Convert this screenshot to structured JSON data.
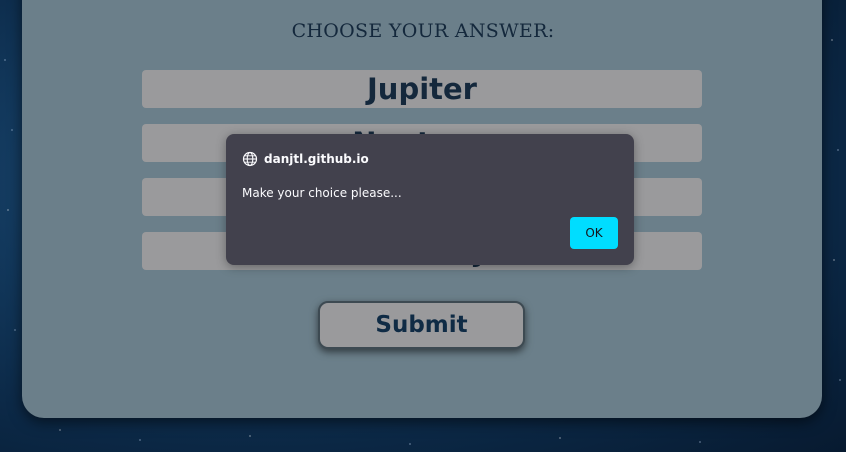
{
  "quiz": {
    "heading": "CHOOSE YOUR ANSWER:",
    "answers": [
      "Jupiter",
      "Neptune",
      "",
      "Mercury"
    ],
    "submit_label": "Submit"
  },
  "dialog": {
    "origin": "danjtl.github.io",
    "origin_icon": "globe-icon",
    "message": "Make your choice please...",
    "ok_label": "OK"
  },
  "colors": {
    "card_background": "#6b7f8a",
    "answer_background": "#9a9a9c",
    "text_dark": "#14283c",
    "dialog_background": "#42414d",
    "ok_button": "#00ddff"
  }
}
